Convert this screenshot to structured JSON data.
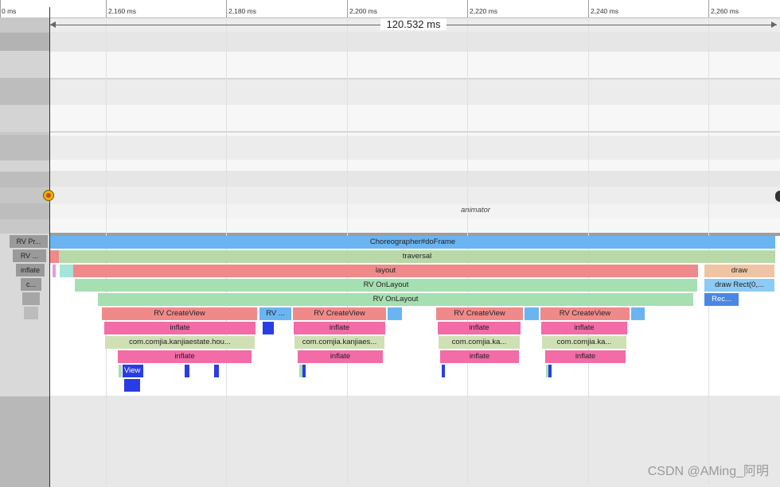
{
  "ruler": {
    "ticks": [
      "0 ms",
      "2,160 ms",
      "2,180 ms",
      "2,200 ms",
      "2,220 ms",
      "2,240 ms",
      "2,260 ms"
    ]
  },
  "duration_label": "120.532 ms",
  "track_labels": {
    "animator": "animator"
  },
  "left_slices": [
    "RV Pr...",
    "RV ...",
    "inflate",
    "c..."
  ],
  "slices": {
    "choreographer": "Choreographer#doFrame",
    "traversal": "traversal",
    "layout": "layout",
    "draw": "draw",
    "rv_onlayout_1": "RV OnLayout",
    "draw_rect": "draw Rect(0,...",
    "rv_onlayout_2": "RV OnLayout",
    "rec": "Rec...",
    "rv_createview_1": "RV CreateView",
    "rv_short": "RV ...",
    "rv_createview_2": "RV CreateView",
    "rv_createview_3": "RV CreateView",
    "rv_createview_4": "RV CreateView",
    "inflate_1": "inflate",
    "inflate_2": "inflate",
    "inflate_3": "inflate",
    "inflate_4": "inflate",
    "com_1": "com.comjia.kanjiaestate.hou...",
    "com_2": "com.comjia.kanjiaes...",
    "com_3": "com.comjia.ka...",
    "com_4": "com.comjia.ka...",
    "inflate_5": "inflate",
    "inflate_6": "inflate",
    "inflate_7": "inflate",
    "inflate_8": "inflate",
    "view": "View"
  },
  "colors": {
    "blue": "#6ab4f2",
    "green": "#b9d8a8",
    "red": "#f08a8a",
    "mint": "#a6dfb1",
    "pink": "#f36ba7",
    "peach": "#efc4a4",
    "lightblue": "#8ccbf5",
    "royal": "#4a86e6",
    "olive": "#cfe0b4",
    "navy": "#2a3ce6"
  },
  "watermark": "CSDN @AMing_阿明"
}
